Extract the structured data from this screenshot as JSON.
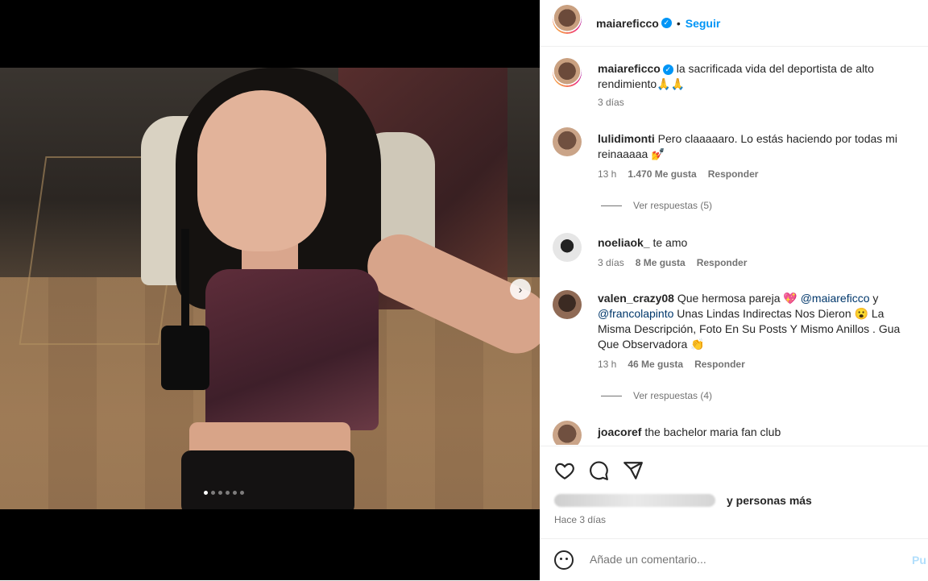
{
  "header": {
    "username": "maiareficco",
    "follow_label": "Seguir",
    "bullet": "•"
  },
  "media": {
    "next_icon": "›",
    "carousel_count": 6,
    "carousel_active_index": 0
  },
  "caption": {
    "username": "maiareficco",
    "text": "la sacrificada vida del deportista de alto rendimiento🙏🙏",
    "time": "3 días"
  },
  "comments": [
    {
      "username": "lulidimonti",
      "text": "Pero claaaaaro. Lo estás haciendo por todas mi reinaaaaa 💅",
      "time": "13 h",
      "likes": "1.470 Me gusta",
      "reply": "Responder",
      "view_replies": "Ver respuestas (5)"
    },
    {
      "username": "noeliaok_",
      "text": "te amo",
      "time": "3 días",
      "likes": "8 Me gusta",
      "reply": "Responder"
    },
    {
      "username": "valen_crazy08",
      "text_a": "Que hermosa pareja 💖",
      "mention_1": "@maiareficco",
      "text_b": "y",
      "mention_2": "@francolapinto",
      "text_c": "Unas Lindas Indirectas Nos Dieron 😮 La Misma Descripción, Foto En Su Posts Y Mismo Anillos . Gua Que Observadora 👏",
      "time": "13 h",
      "likes": "46 Me gusta",
      "reply": "Responder",
      "view_replies": "Ver respuestas (4)"
    },
    {
      "username": "joacoref",
      "text": "the bachelor maria fan club"
    }
  ],
  "likes_line": {
    "text": "y personas más"
  },
  "time_ago": "Hace 3 días",
  "add_comment": {
    "placeholder": "Añade un comentario...",
    "post_label": "Pu"
  },
  "colors": {
    "accent": "#0095f6",
    "text": "#262626",
    "muted": "#737373"
  }
}
